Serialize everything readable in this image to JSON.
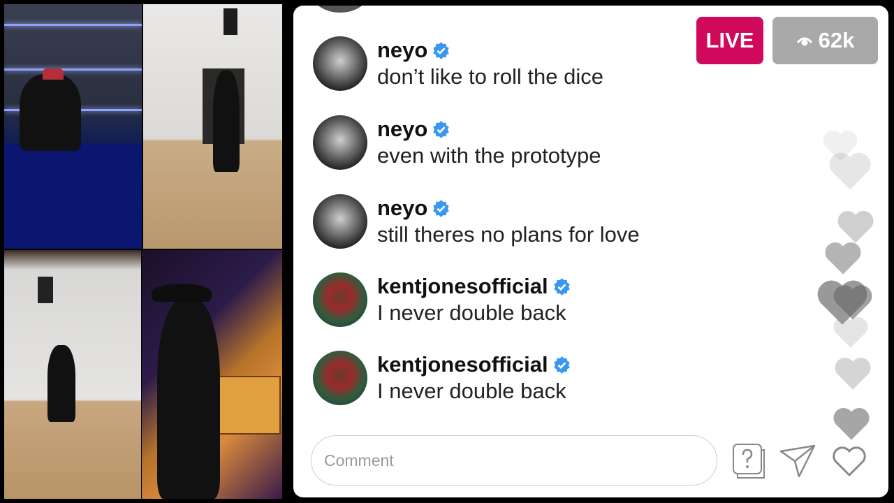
{
  "live_badge": {
    "label": "LIVE",
    "color": "#d1095c"
  },
  "viewers": {
    "icon": "eye-icon",
    "count": "62k"
  },
  "comments": [
    {
      "user": "neyo",
      "verified": true,
      "avatar": "neyo-avatar",
      "text": "don’t like to roll the dice"
    },
    {
      "user": "neyo",
      "verified": true,
      "avatar": "neyo-avatar",
      "text": "even with the prototype"
    },
    {
      "user": "neyo",
      "verified": true,
      "avatar": "neyo-avatar",
      "text": "still theres no plans for love"
    },
    {
      "user": "kentjonesofficial",
      "verified": true,
      "avatar": "kent-avatar",
      "text": "I never double back"
    },
    {
      "user": "kentjonesofficial",
      "verified": true,
      "avatar": "kent-avatar",
      "text": "I never double back"
    }
  ],
  "composer": {
    "placeholder": "Comment",
    "icons": [
      "question-box-icon",
      "send-icon",
      "heart-icon"
    ]
  },
  "colors": {
    "verified": "#3897f0",
    "viewer_badge": "#a9a9a9",
    "panel": "#ffffff"
  }
}
